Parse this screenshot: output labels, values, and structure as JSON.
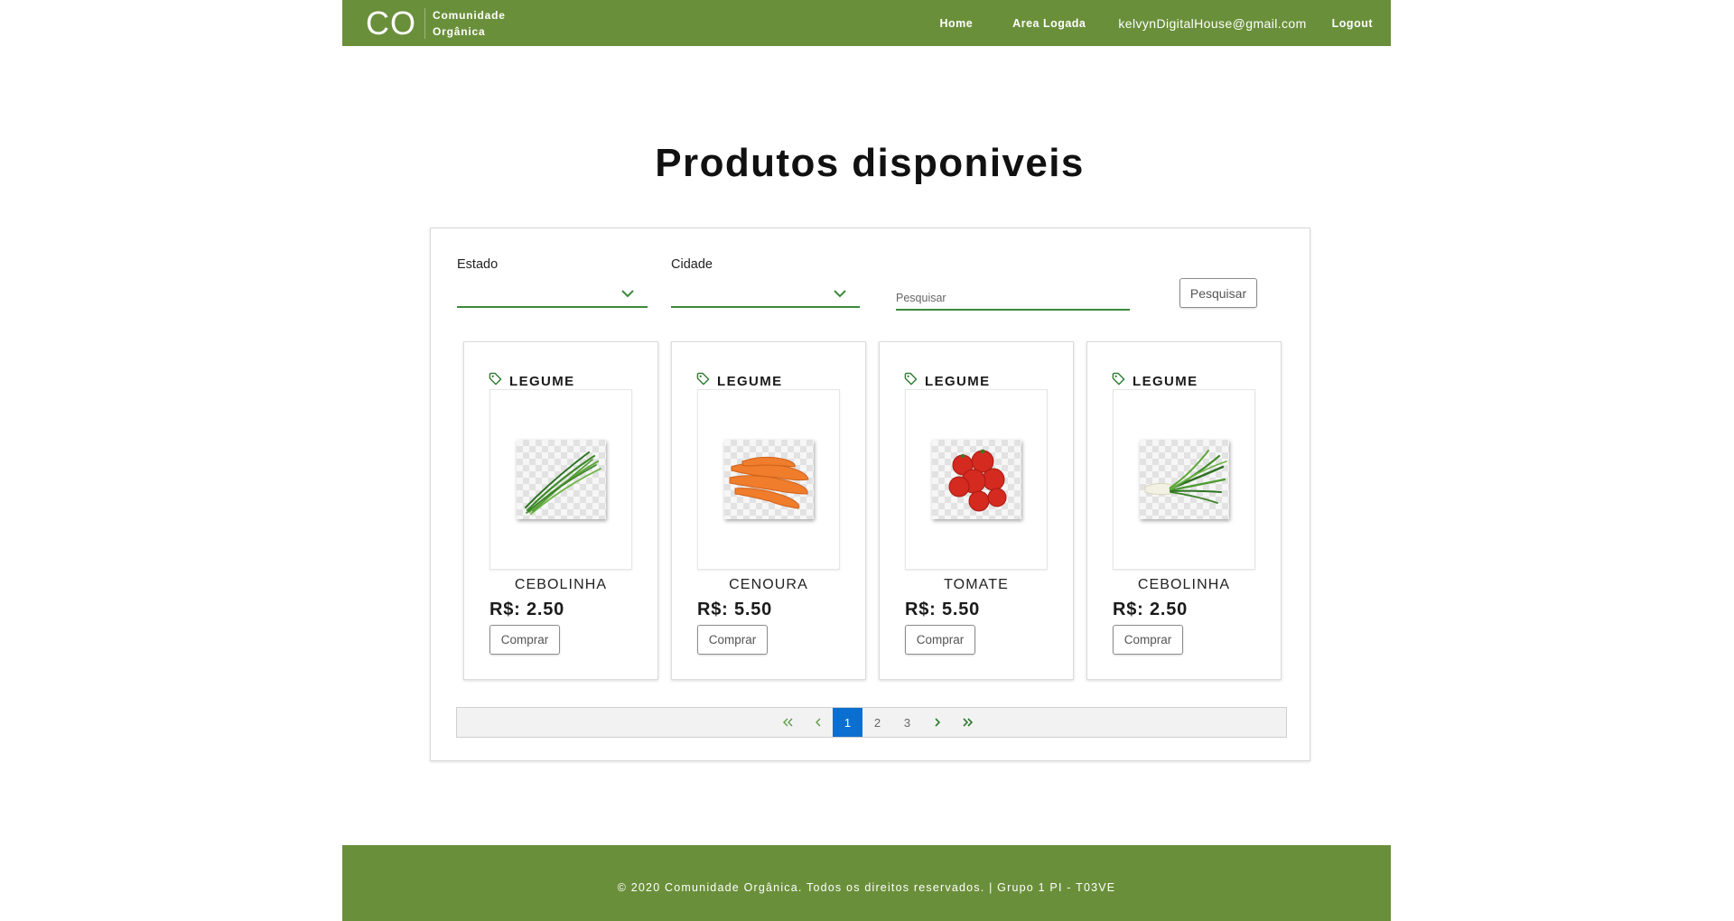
{
  "header": {
    "logo_mark": "CO",
    "logo_line1": "Comunidade",
    "logo_line2": "Orgânica",
    "nav": {
      "home": "Home",
      "area_logada": "Area Logada",
      "email": "kelvynDigitalHouse@gmail.com",
      "logout": "Logout"
    }
  },
  "page": {
    "title": "Produtos disponiveis"
  },
  "filters": {
    "estado_label": "Estado",
    "estado_value": "",
    "cidade_label": "Cidade",
    "cidade_value": "",
    "search_placeholder": "Pesquisar",
    "search_value": "",
    "search_button": "Pesquisar"
  },
  "products": [
    {
      "category": "LEGUME",
      "name": "CEBOLINHA",
      "price": "R$: 2.50",
      "buy_label": "Comprar",
      "image_icon": "chives-image"
    },
    {
      "category": "LEGUME",
      "name": "CENOURA",
      "price": "R$: 5.50",
      "buy_label": "Comprar",
      "image_icon": "carrots-image"
    },
    {
      "category": "LEGUME",
      "name": "TOMATE",
      "price": "R$: 5.50",
      "buy_label": "Comprar",
      "image_icon": "tomatoes-image"
    },
    {
      "category": "LEGUME",
      "name": "CEBOLINHA",
      "price": "R$: 2.50",
      "buy_label": "Comprar",
      "image_icon": "green-onions-image"
    }
  ],
  "pagination": {
    "first": "«",
    "prev": "‹",
    "pages": [
      "1",
      "2",
      "3"
    ],
    "current_page": "1",
    "next": "›",
    "last": "»"
  },
  "footer": {
    "text": "© 2020 Comunidade Orgânica. Todos os direitos reservados. | Grupo 1 PI - T03VE"
  },
  "colors": {
    "brand_green": "#6a8f3a",
    "accent_green": "#3b8a3b",
    "active_page_blue": "#0a6fd1"
  }
}
